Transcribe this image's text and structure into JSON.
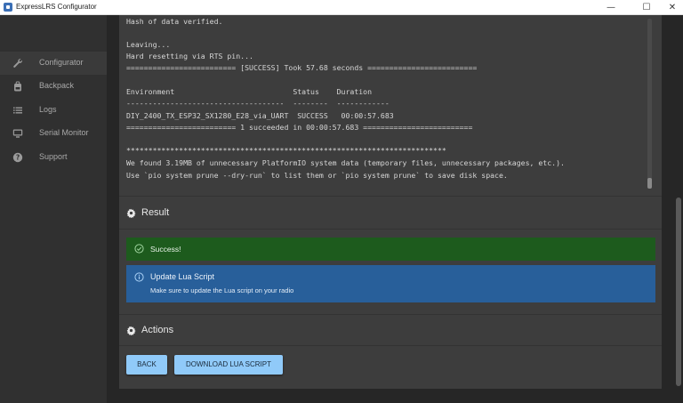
{
  "window": {
    "title": "ExpressLRS Configurator",
    "controls": {
      "minimize": "—",
      "maximize": "☐",
      "close": "✕"
    }
  },
  "sidebar": {
    "items": [
      {
        "label": "Configurator",
        "icon": "wrench-icon",
        "active": true
      },
      {
        "label": "Backpack",
        "icon": "backpack-icon",
        "active": false
      },
      {
        "label": "Logs",
        "icon": "list-icon",
        "active": false
      },
      {
        "label": "Serial Monitor",
        "icon": "monitor-icon",
        "active": false
      },
      {
        "label": "Support",
        "icon": "help-icon",
        "active": false
      }
    ]
  },
  "log": {
    "lines": [
      "Hash of data verified.",
      "",
      "Leaving...",
      "Hard resetting via RTS pin...",
      "========================= [SUCCESS] Took 57.68 seconds =========================",
      "",
      "Environment                           Status    Duration",
      "------------------------------------  --------  ------------",
      "DIY_2400_TX_ESP32_SX1280_E28_via_UART  SUCCESS   00:00:57.683",
      "========================= 1 succeeded in 00:00:57.683 =========================",
      "",
      "*************************************************************************",
      "We found 3.19MB of unnecessary PlatformIO system data (temporary files, unnecessary packages, etc.).",
      "Use `pio system prune --dry-run` to list them or `pio system prune` to save disk space."
    ]
  },
  "result": {
    "heading": "Result",
    "success_text": "Success!",
    "info_title": "Update Lua Script",
    "info_desc": "Make sure to update the Lua script on your radio"
  },
  "actions": {
    "heading": "Actions",
    "back_label": "BACK",
    "download_label": "DOWNLOAD LUA SCRIPT"
  },
  "colors": {
    "success_bg": "#1d5b1d",
    "info_bg": "#285f9a",
    "button_bg": "#90caf9",
    "panel_bg": "#3d3d3d",
    "sidebar_bg": "#303030"
  }
}
